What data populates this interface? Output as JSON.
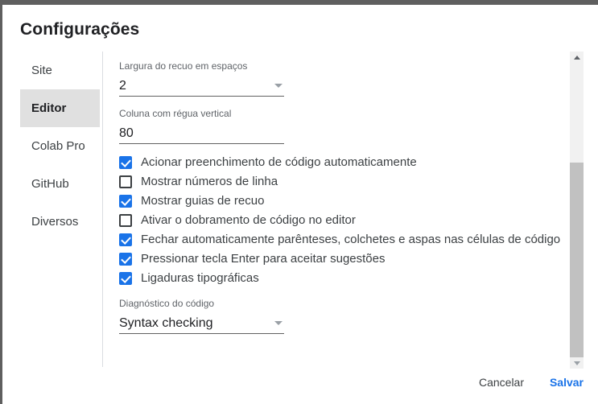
{
  "dialog": {
    "title": "Configurações"
  },
  "sidebar": {
    "items": [
      {
        "label": "Site",
        "active": false
      },
      {
        "label": "Editor",
        "active": true
      },
      {
        "label": "Colab Pro",
        "active": false
      },
      {
        "label": "GitHub",
        "active": false
      },
      {
        "label": "Diversos",
        "active": false
      }
    ]
  },
  "fields": {
    "indent_width": {
      "label": "Largura do recuo em espaços",
      "value": "2",
      "control": "select",
      "caret_icon": "chevron-down-icon"
    },
    "vertical_ruler": {
      "label": "Coluna com régua vertical",
      "value": "80",
      "control": "text"
    },
    "code_diagnostics": {
      "label": "Diagnóstico do código",
      "value": "Syntax checking",
      "control": "select",
      "caret_icon": "chevron-down-icon"
    }
  },
  "checkboxes": [
    {
      "label": "Acionar preenchimento de código automaticamente",
      "checked": true
    },
    {
      "label": "Mostrar números de linha",
      "checked": false
    },
    {
      "label": "Mostrar guias de recuo",
      "checked": true
    },
    {
      "label": "Ativar o dobramento de código no editor",
      "checked": false
    },
    {
      "label": "Fechar automaticamente parênteses, colchetes e aspas nas células de código",
      "checked": true
    },
    {
      "label": "Pressionar tecla Enter para aceitar sugestões",
      "checked": true
    },
    {
      "label": "Ligaduras tipográficas",
      "checked": true
    }
  ],
  "scrollbar": {
    "up_icon": "scroll-up-arrow-icon",
    "down_icon": "scroll-down-arrow-icon"
  },
  "footer": {
    "cancel_label": "Cancelar",
    "save_label": "Salvar"
  },
  "colors": {
    "accent": "#1a73e8",
    "checkbox_checked": "#1a73e8",
    "active_item_bg": "#e0e0e0",
    "text_primary": "#202124",
    "text_secondary": "#5f6368",
    "backdrop": "#5f5f5f"
  }
}
